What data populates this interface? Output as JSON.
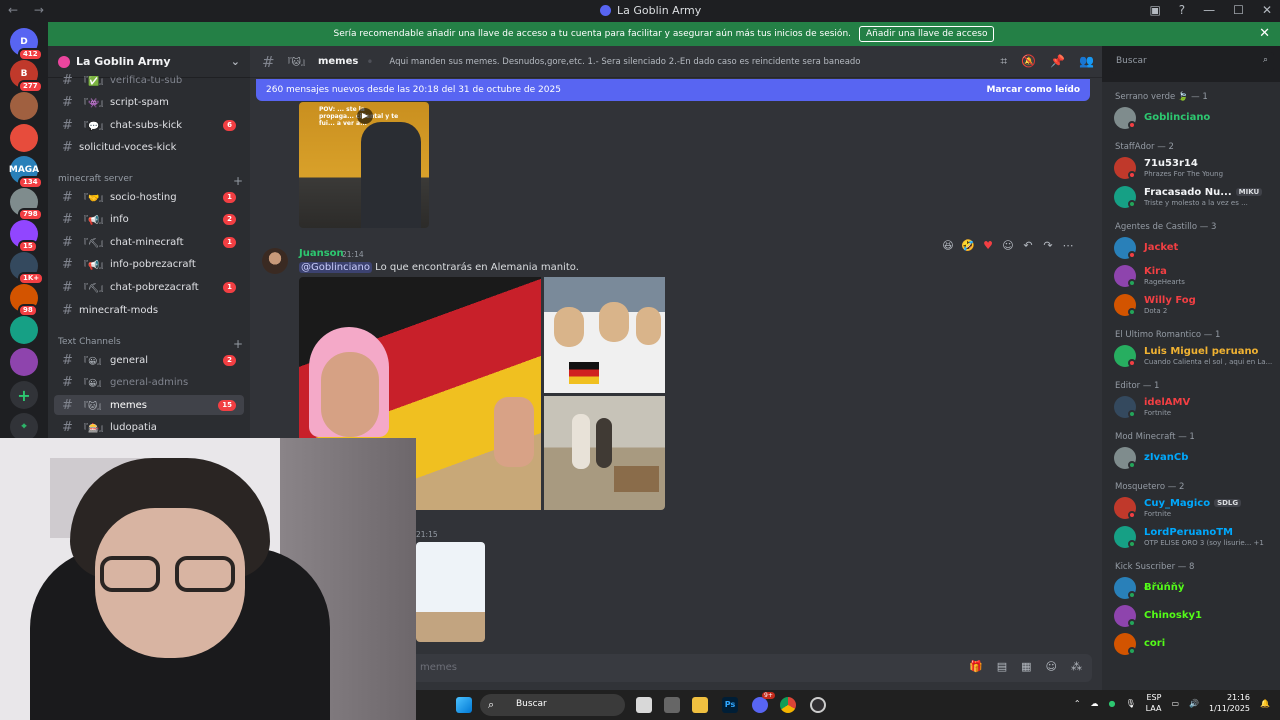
{
  "window": {
    "title": "La Goblin Army",
    "nav_arrows": "← →"
  },
  "guilds": [
    {
      "label": "D",
      "badge": "412",
      "color": "#5865f2"
    },
    {
      "label": "B",
      "badge": "277",
      "color": "#c0392b"
    },
    {
      "label": "",
      "badge": "",
      "color": "#a06040"
    },
    {
      "label": "",
      "badge": "",
      "color": "#e74c3c"
    },
    {
      "label": "MAGA",
      "badge": "134",
      "color": "#2980b9"
    },
    {
      "label": "",
      "badge": "798",
      "color": "#7f8c8d"
    },
    {
      "label": "",
      "badge": "15",
      "color": "#9146ff"
    },
    {
      "label": "",
      "badge": "1K+",
      "color": "#34495e"
    },
    {
      "label": "",
      "badge": "98",
      "color": "#d35400"
    },
    {
      "label": "",
      "badge": "",
      "color": "#16a085"
    },
    {
      "label": "",
      "badge": "",
      "color": "#8e44ad"
    }
  ],
  "banner": {
    "text": "Sería recomendable añadir una llave de acceso a tu cuenta para facilitar y asegurar aún más tus inicios de sesión.",
    "button": "Añadir una llave de acceso",
    "close": "✕"
  },
  "server": {
    "name": "La Goblin Army"
  },
  "channels": [
    {
      "emoji": "『✅』",
      "name": "verifica-tu-sub",
      "badge": "",
      "muted": true,
      "active": false
    },
    {
      "emoji": "『👾』",
      "name": "script-spam",
      "badge": "",
      "muted": false,
      "active": false
    },
    {
      "emoji": "『💬』",
      "name": "chat-subs-kick",
      "badge": "6",
      "muted": false,
      "active": false
    },
    {
      "emoji": "",
      "name": "solicitud-voces-kick",
      "badge": "",
      "muted": false,
      "active": false
    }
  ],
  "categories": {
    "minecraft": "minecraft server",
    "text": "Text Channels"
  },
  "minecraft_channels": [
    {
      "emoji": "『🤝』",
      "name": "socio-hosting",
      "badge": "1"
    },
    {
      "emoji": "『📢』",
      "name": "info",
      "badge": "2"
    },
    {
      "emoji": "『⛏』",
      "name": "chat-minecraft",
      "badge": "1"
    },
    {
      "emoji": "『📢』",
      "name": "info-pobrezacraft",
      "badge": ""
    },
    {
      "emoji": "『⛏』",
      "name": "chat-pobrezacraft",
      "badge": "1"
    },
    {
      "emoji": "",
      "name": "minecraft-mods",
      "badge": ""
    }
  ],
  "text_channels": [
    {
      "emoji": "『😀』",
      "name": "general",
      "badge": "2",
      "muted": false,
      "active": false
    },
    {
      "emoji": "『😀』",
      "name": "general-admins",
      "badge": "",
      "muted": true,
      "active": false
    },
    {
      "emoji": "『🐱』",
      "name": "memes",
      "badge": "15",
      "muted": false,
      "active": true
    },
    {
      "emoji": "『🎰』",
      "name": "ludopatia",
      "badge": "",
      "muted": false,
      "active": false
    }
  ],
  "channel_header": {
    "emoji": "『🐱』",
    "name": "memes",
    "topic": "Aqui manden sus memes. Desnudos,gore,etc. 1.- Sera silenciado 2.-En dado caso es reincidente sera baneado"
  },
  "search": {
    "placeholder": "Buscar"
  },
  "new_messages": {
    "text": "260 mensajes nuevos desde las 20:18 del 31 de octubre de 2025",
    "action": "Marcar como leído"
  },
  "message": {
    "author": "Juanson",
    "time": "21:14",
    "mention": "@Goblinciano",
    "text": "Lo que encontrarás en Alemania manito."
  },
  "video_caption": "POV: ... ste la propaga... cidental y te fui... a ver a...",
  "next_message_time": "21:15",
  "input": {
    "placeholder": "memes"
  },
  "members": {
    "roles": [
      {
        "name": "Serrano verde 🍃 — 1",
        "members": [
          {
            "name": "Goblinciano",
            "color": "#2dc770",
            "status": "",
            "dot": "#f23f43"
          }
        ]
      },
      {
        "name": "StaffAdor — 2",
        "members": [
          {
            "name": "71u53r14",
            "color": "#f2f3f5",
            "status": "Phrazes For The Young",
            "dot": "#f23f43"
          },
          {
            "name": "Fracasado Nu...",
            "color": "#f2f3f5",
            "status": "Triste y molesto a la vez es ...",
            "dot": "#23a55a",
            "tag": "MIKU"
          }
        ]
      },
      {
        "name": "Agentes de Castillo — 3",
        "members": [
          {
            "name": "Jacket",
            "color": "#f23f43",
            "status": "",
            "dot": "#f23f43"
          },
          {
            "name": "Kira",
            "color": "#f23f43",
            "status": "RageHearts",
            "dot": "#23a55a"
          },
          {
            "name": "Willy Fog",
            "color": "#f23f43",
            "status": "Dota 2",
            "dot": "#23a55a"
          }
        ]
      },
      {
        "name": "El Ultimo Romantico — 1",
        "members": [
          {
            "name": "Luis Miguel peruano",
            "color": "#f0b232",
            "status": "Cuando Calienta el sol , aqui en La...",
            "dot": "#f23f43"
          }
        ]
      },
      {
        "name": "Editor — 1",
        "members": [
          {
            "name": "idelAMV",
            "color": "#f23f43",
            "status": "Fortnite",
            "dot": "#23a55a"
          }
        ]
      },
      {
        "name": "Mod Minecraft — 1",
        "members": [
          {
            "name": "zIvanCb",
            "color": "#00a8fc",
            "status": "",
            "dot": "#23a55a"
          }
        ]
      },
      {
        "name": "Mosquetero — 2",
        "members": [
          {
            "name": "Cuy_Magico",
            "color": "#00a8fc",
            "status": "Fortnite",
            "dot": "#f23f43",
            "tag": "SDLG"
          },
          {
            "name": "LordPeruanoTM",
            "color": "#00a8fc",
            "status": "OTP ELISE ORO 3 (soy lisurie... +1",
            "dot": "#23a55a"
          }
        ]
      },
      {
        "name": "Kick Suscriber — 8",
        "members": [
          {
            "name": "Ƀřŭńňÿ",
            "color": "#53fc18",
            "status": "",
            "dot": "#23a55a"
          },
          {
            "name": "Chinosky1",
            "color": "#53fc18",
            "status": "",
            "dot": "#23a55a"
          },
          {
            "name": "cori",
            "color": "#53fc18",
            "status": "",
            "dot": "#23a55a"
          }
        ]
      }
    ]
  },
  "taskbar": {
    "search": "Buscar",
    "lang1": "ESP",
    "lang2": "LAA",
    "time": "21:16",
    "date": "1/11/2025",
    "discord_badge": "9+"
  },
  "colors": {
    "accent": "#5865f2",
    "banner": "#248046",
    "unread": "#f23f43"
  }
}
